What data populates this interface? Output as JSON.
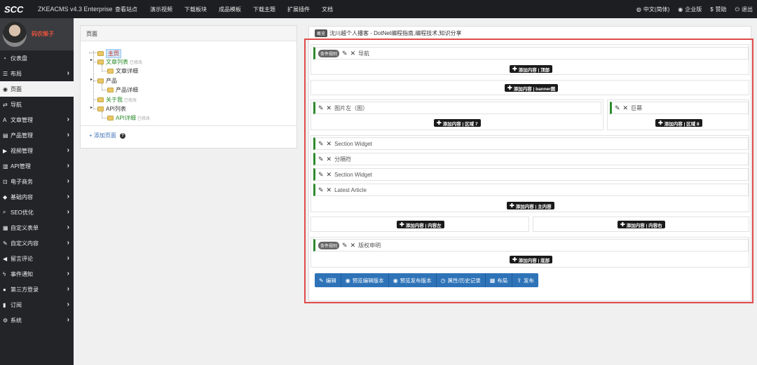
{
  "topbar": {
    "logo": "SCC",
    "brand": "ZKEACMS v4.3 Enterprise",
    "nav": [
      "查看站点",
      "演示视频",
      "下载板块",
      "成品模板",
      "下载主题",
      "扩展插件",
      "文档"
    ],
    "right": [
      {
        "icon": "globe-icon",
        "glyph": "◍",
        "label": "中文(简体)"
      },
      {
        "icon": "enterprise-icon",
        "glyph": "◉",
        "label": "企业版"
      },
      {
        "icon": "dollar-icon",
        "glyph": "$",
        "label": "赞助"
      },
      {
        "icon": "power-icon",
        "glyph": "⏻",
        "label": "退出"
      }
    ]
  },
  "sidebar": {
    "username": "码农猴子",
    "items": [
      {
        "icon": "dashboard-icon",
        "glyph": "◔",
        "label": "仪表盘",
        "chevron": false,
        "active": false
      },
      {
        "icon": "layout-icon",
        "glyph": "☰",
        "label": "布局",
        "chevron": true,
        "active": false
      },
      {
        "icon": "eye-icon",
        "glyph": "◉",
        "label": "页面",
        "chevron": false,
        "active": true
      },
      {
        "icon": "navigation-icon",
        "glyph": "⇄",
        "label": "导航",
        "chevron": false,
        "active": false
      },
      {
        "icon": "text-icon",
        "glyph": "A",
        "label": "文章管理",
        "chevron": true,
        "active": false
      },
      {
        "icon": "product-icon",
        "glyph": "▤",
        "label": "产品管理",
        "chevron": true,
        "active": false
      },
      {
        "icon": "video-icon",
        "glyph": "▶",
        "label": "视频管理",
        "chevron": true,
        "active": false
      },
      {
        "icon": "api-icon",
        "glyph": "▥",
        "label": "API管理",
        "chevron": true,
        "active": false
      },
      {
        "icon": "cart-icon",
        "glyph": "⊡",
        "label": "电子商务",
        "chevron": true,
        "active": false
      },
      {
        "icon": "diamond-icon",
        "glyph": "◆",
        "label": "基础内容",
        "chevron": true,
        "active": false
      },
      {
        "icon": "search-icon",
        "glyph": "⌕",
        "label": "SEO优化",
        "chevron": true,
        "active": false
      },
      {
        "icon": "form-icon",
        "glyph": "▦",
        "label": "自定义表单",
        "chevron": true,
        "active": false
      },
      {
        "icon": "wrench-icon",
        "glyph": "✎",
        "label": "自定义内容",
        "chevron": true,
        "active": false
      },
      {
        "icon": "megaphone-icon",
        "glyph": "◀",
        "label": "留言评论",
        "chevron": true,
        "active": false
      },
      {
        "icon": "bolt-icon",
        "glyph": "ϟ",
        "label": "事件通知",
        "chevron": true,
        "active": false
      },
      {
        "icon": "user-icon",
        "glyph": "●",
        "label": "第三方登录",
        "chevron": true,
        "active": false
      },
      {
        "icon": "book-icon",
        "glyph": "▮",
        "label": "订阅",
        "chevron": true,
        "active": false
      },
      {
        "icon": "gear-icon",
        "glyph": "⚙",
        "label": "系统",
        "chevron": true,
        "active": false
      }
    ]
  },
  "pages_panel": {
    "title": "页面",
    "edited_text": "已修改",
    "tree": {
      "home": "主页",
      "article_list": "文章列表",
      "article_detail": "文章详细",
      "product": "产品",
      "product_detail": "产品详细",
      "about": "关于我",
      "api_list": "API列表",
      "api_detail": "API详细"
    },
    "add_page": "添加页面",
    "help": "?"
  },
  "design_panel": {
    "overview_tag": "概览",
    "page_title": "沈川越个人播客 - DotNet编程指南,编程技术,知识分享",
    "condition_tag": "条件规则",
    "widgets": {
      "nav": "导航",
      "img_left": "图片左（图）",
      "banner_widget": "巨幕",
      "section1": "Section Widget",
      "divider": "分隔符",
      "section2": "Section Widget",
      "latest": "Latest Article",
      "copyright": "版权申明"
    },
    "add_buttons": {
      "top": "添加内容 | 顶部",
      "banner": "添加内容 | banner图",
      "zone7": "添加内容 | 区域 7",
      "zone8": "添加内容 | 区域 8",
      "main": "添加内容 | 主内容",
      "left": "添加内容 | 内容左",
      "right": "添加内容 | 内容右",
      "bottom": "添加内容 | 底部"
    },
    "toolbar": [
      {
        "icon": "edit-icon",
        "glyph": "✎",
        "label": "编辑"
      },
      {
        "icon": "eye-icon",
        "glyph": "◉",
        "label": "预览编辑版本"
      },
      {
        "icon": "eye-icon",
        "glyph": "◉",
        "label": "预览发布版本"
      },
      {
        "icon": "history-icon",
        "glyph": "◷",
        "label": "属性/历史记录"
      },
      {
        "icon": "grid-icon",
        "glyph": "▦",
        "label": "布局"
      },
      {
        "icon": "upload-icon",
        "glyph": "⇪",
        "label": "发布"
      }
    ]
  },
  "colors": {
    "topbar": "#1c1e21",
    "sidebar": "#222428",
    "accent_green": "#2e8b2e",
    "toolbar_blue": "#2e73b8",
    "highlight_red": "#e14b4b"
  }
}
